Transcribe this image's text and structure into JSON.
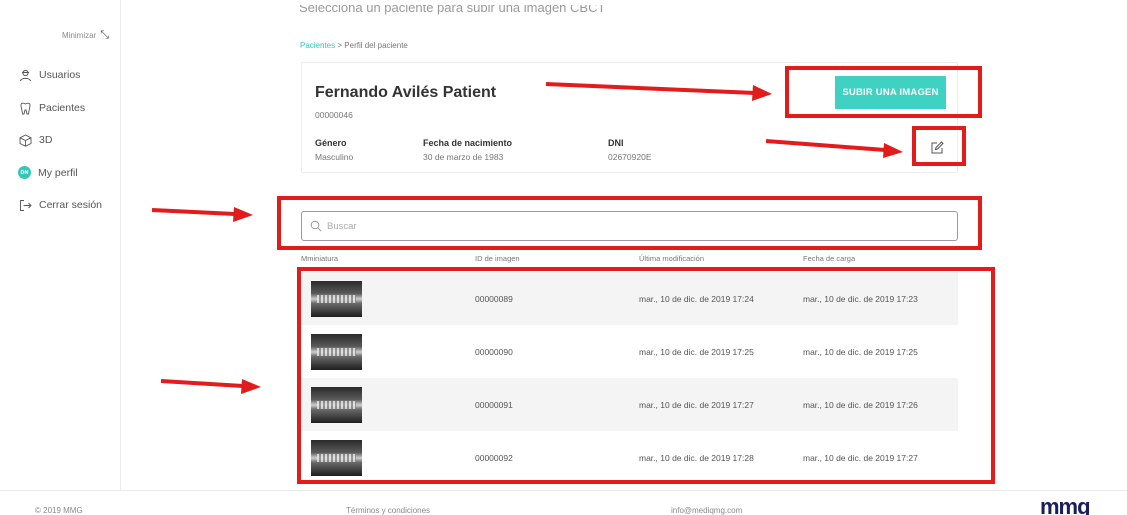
{
  "sidebar": {
    "minimize_label": "Minimizar",
    "items": [
      {
        "label": "Usuarios",
        "icon": "users-icon"
      },
      {
        "label": "Pacientes",
        "icon": "tooth-icon"
      },
      {
        "label": "3D",
        "icon": "cube-icon"
      },
      {
        "label": "My perfil",
        "icon": "avatar-icon",
        "avatar_initials": "DN"
      },
      {
        "label": "Cerrar sesión",
        "icon": "logout-icon"
      }
    ]
  },
  "page": {
    "top_text": "Selecciona un paciente para subir una imagen CBCT",
    "breadcrumb_link": "Pacientes",
    "breadcrumb_sep": ">",
    "breadcrumb_current": "Perfil del paciente"
  },
  "patient": {
    "name": "Fernando Avilés Patient",
    "id": "00000046",
    "fields": [
      {
        "label": "Género",
        "value": "Masculino"
      },
      {
        "label": "Fecha de nacimiento",
        "value": "30 de marzo de 1983"
      },
      {
        "label": "DNI",
        "value": "02670920E"
      }
    ],
    "upload_label": "SUBIR UNA IMAGEN"
  },
  "search": {
    "placeholder": "Buscar",
    "value": ""
  },
  "table": {
    "headers": [
      "Mminiatura",
      "ID de imagen",
      "Última modificación",
      "Fecha de carga"
    ],
    "rows": [
      {
        "id": "00000089",
        "modified": "mar., 10 de dic. de 2019 17:24",
        "uploaded": "mar., 10 de dic. de 2019 17:23"
      },
      {
        "id": "00000090",
        "modified": "mar., 10 de dic. de 2019 17:25",
        "uploaded": "mar., 10 de dic. de 2019 17:25"
      },
      {
        "id": "00000091",
        "modified": "mar., 10 de dic. de 2019 17:27",
        "uploaded": "mar., 10 de dic. de 2019 17:26"
      },
      {
        "id": "00000092",
        "modified": "mar., 10 de dic. de 2019 17:28",
        "uploaded": "mar., 10 de dic. de 2019 17:27"
      }
    ]
  },
  "footer": {
    "copyright": "© 2019 MMG",
    "terms": "Términos y condiciones",
    "email": "info@mediqmg.com",
    "logo_text": "mmg"
  },
  "colors": {
    "accent": "#3fd1c1",
    "annotation": "#e21b1b",
    "logo": "#1a1f5c"
  }
}
